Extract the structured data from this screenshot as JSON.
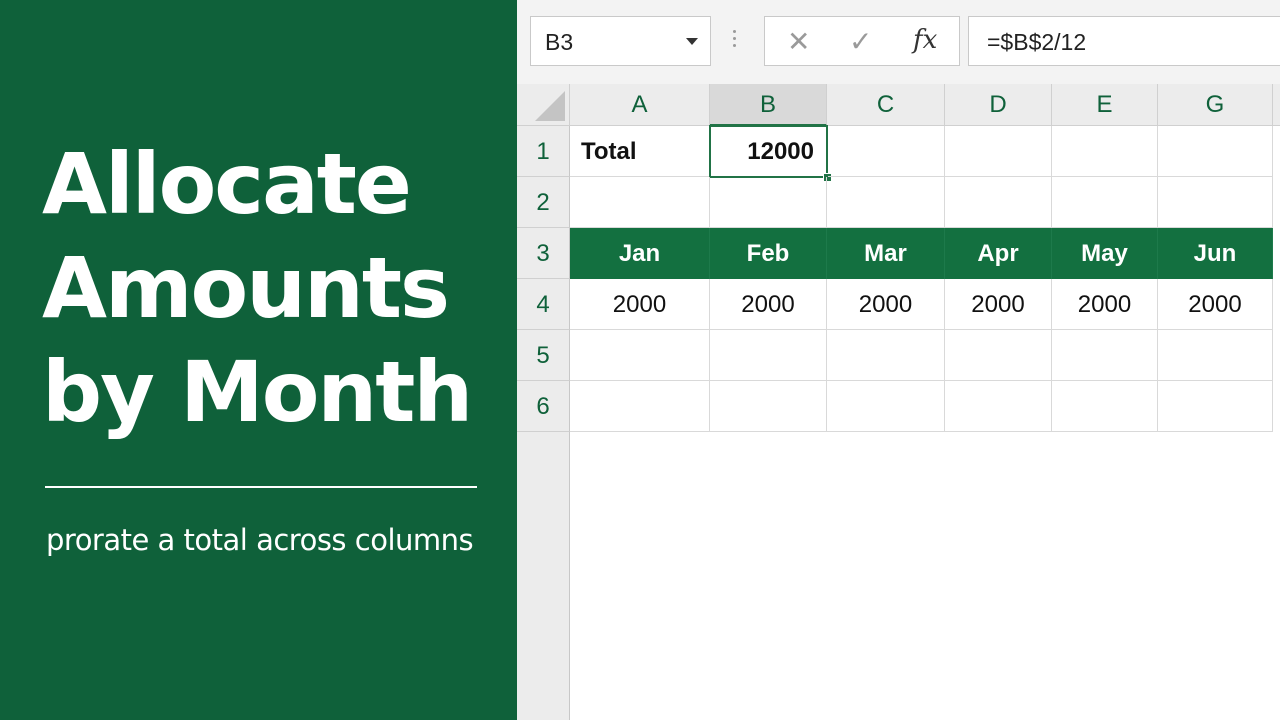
{
  "hero": {
    "title_lines": [
      "Allocate",
      "Amounts",
      "by Month"
    ],
    "subtitle": "prorate a total across columns"
  },
  "formula_bar": {
    "name_box": "B3",
    "formula": "=$B$2/12",
    "icons": [
      "dropdown-icon",
      "cancel-icon",
      "enter-icon",
      "fx-icon"
    ]
  },
  "grid": {
    "columns": [
      "A",
      "B",
      "C",
      "D",
      "E",
      "G"
    ],
    "rows": [
      "1",
      "2",
      "3",
      "4",
      "5",
      "6"
    ],
    "cells": {
      "r1": [
        "Total",
        "12000",
        "",
        "",
        "",
        ""
      ],
      "r2": [
        "",
        "",
        "",
        "",
        "",
        ""
      ],
      "r3": [
        "Jan",
        "Feb",
        "Mar",
        "Apr",
        "May",
        "Jun"
      ],
      "r4": [
        "2000",
        "2000",
        "2000",
        "2000",
        "2000",
        "2000"
      ],
      "r5": [
        "",
        "",
        "",
        "",
        "",
        ""
      ],
      "r6": [
        "",
        "",
        "",
        "",
        "",
        ""
      ]
    },
    "active_column": "B",
    "selected_cell": "B1"
  },
  "colors": {
    "brand_green": "#0f613a",
    "header_band": "#137040",
    "selection": "#217346"
  }
}
